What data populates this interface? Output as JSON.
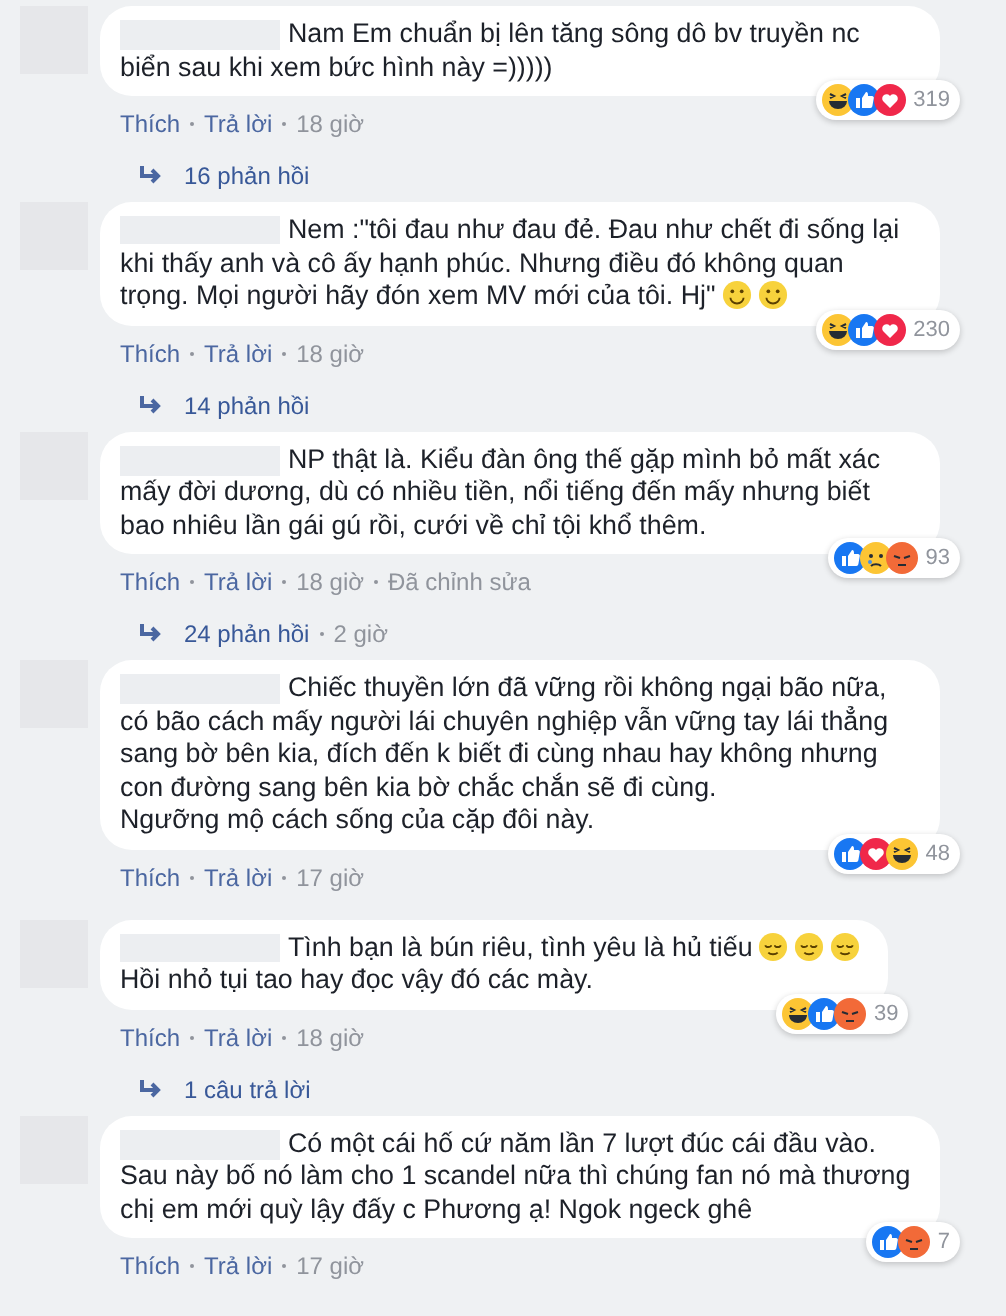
{
  "comments": [
    {
      "paragraphs": [
        {
          "text": "Nam Em chuẩn bị lên tăng sông dô bv truyền nc biển sau khi xem bức hình này =)))))"
        }
      ],
      "reactions": [
        {
          "kind": "haha"
        },
        {
          "kind": "like"
        },
        {
          "kind": "love"
        }
      ],
      "reaction_count": "319",
      "actions": [
        "Thích",
        "Trả lời"
      ],
      "time": "18 giờ",
      "replies": {
        "label": "16 phản hồi"
      }
    },
    {
      "paragraphs": [
        {
          "text": "Nem :\"tôi đau như đau đẻ. Đau như chết đi sống lại khi thấy anh và cô ấy hạnh phúc. Nhưng điều đó không quan trọng. Mọi người hãy đón xem MV mới của tôi. Hj\"",
          "emoji": [
            {
              "kind": "smile"
            },
            {
              "kind": "smile"
            }
          ]
        }
      ],
      "reactions": [
        {
          "kind": "haha"
        },
        {
          "kind": "like"
        },
        {
          "kind": "love"
        }
      ],
      "reaction_count": "230",
      "actions": [
        "Thích",
        "Trả lời"
      ],
      "time": "18 giờ",
      "replies": {
        "label": "14 phản hồi"
      }
    },
    {
      "paragraphs": [
        {
          "text": "NP thật là. Kiểu đàn ông thế gặp mình bỏ mất xác mấy đời dương, dù có nhiều tiền, nổi tiếng đến mấy nhưng biết bao nhiêu lần gái gú rồi, cưới về chỉ tội khổ thêm."
        }
      ],
      "reactions": [
        {
          "kind": "like"
        },
        {
          "kind": "sad"
        },
        {
          "kind": "angry"
        }
      ],
      "reaction_count": "93",
      "actions": [
        "Thích",
        "Trả lời"
      ],
      "time": "18 giờ",
      "edited": "Đã chỉnh sửa",
      "replies": {
        "label": "24 phản hồi",
        "time": "2 giờ"
      }
    },
    {
      "paragraphs": [
        {
          "text": "Chiếc thuyền lớn đã vững rồi không ngại bão nữa, có bão cách mấy người lái chuyên nghiệp vẫn vững tay lái thẳng sang bờ bên kia, đích đến k biết đi cùng nhau hay không nhưng con đường sang bên kia bờ chắc chắn sẽ đi cùng."
        },
        {
          "text": "Ngưỡng mộ cách sống của cặp đôi này."
        }
      ],
      "reactions": [
        {
          "kind": "like"
        },
        {
          "kind": "love"
        },
        {
          "kind": "haha"
        }
      ],
      "reaction_count": "48",
      "actions": [
        "Thích",
        "Trả lời"
      ],
      "time": "17 giờ"
    },
    {
      "paragraphs": [
        {
          "text": "Tình bạn là bún riêu, tình yêu là hủ tiếu",
          "emoji": [
            {
              "kind": "relieved"
            },
            {
              "kind": "relieved"
            },
            {
              "kind": "relieved"
            }
          ]
        },
        {
          "text": "Hồi nhỏ tụi tao hay đọc vậy đó các mày."
        }
      ],
      "reactions": [
        {
          "kind": "haha"
        },
        {
          "kind": "like"
        },
        {
          "kind": "angry"
        }
      ],
      "reaction_count": "39",
      "actions": [
        "Thích",
        "Trả lời"
      ],
      "time": "18 giờ",
      "replies": {
        "label": "1 câu trả lời"
      }
    },
    {
      "paragraphs": [
        {
          "text": "Có một cái hố cứ năm lần 7 lượt đúc cái đầu vào. Sau này bố nó làm cho 1 scandel nữa thì chúng fan nó mà thương chị em mới quỳ lậy đấy c Phương ạ! Ngok ngeck ghê"
        }
      ],
      "reactions": [
        {
          "kind": "like"
        },
        {
          "kind": "angry"
        }
      ],
      "reaction_count": "7",
      "actions": [
        "Thích",
        "Trả lời"
      ],
      "time": "17 giờ"
    }
  ]
}
